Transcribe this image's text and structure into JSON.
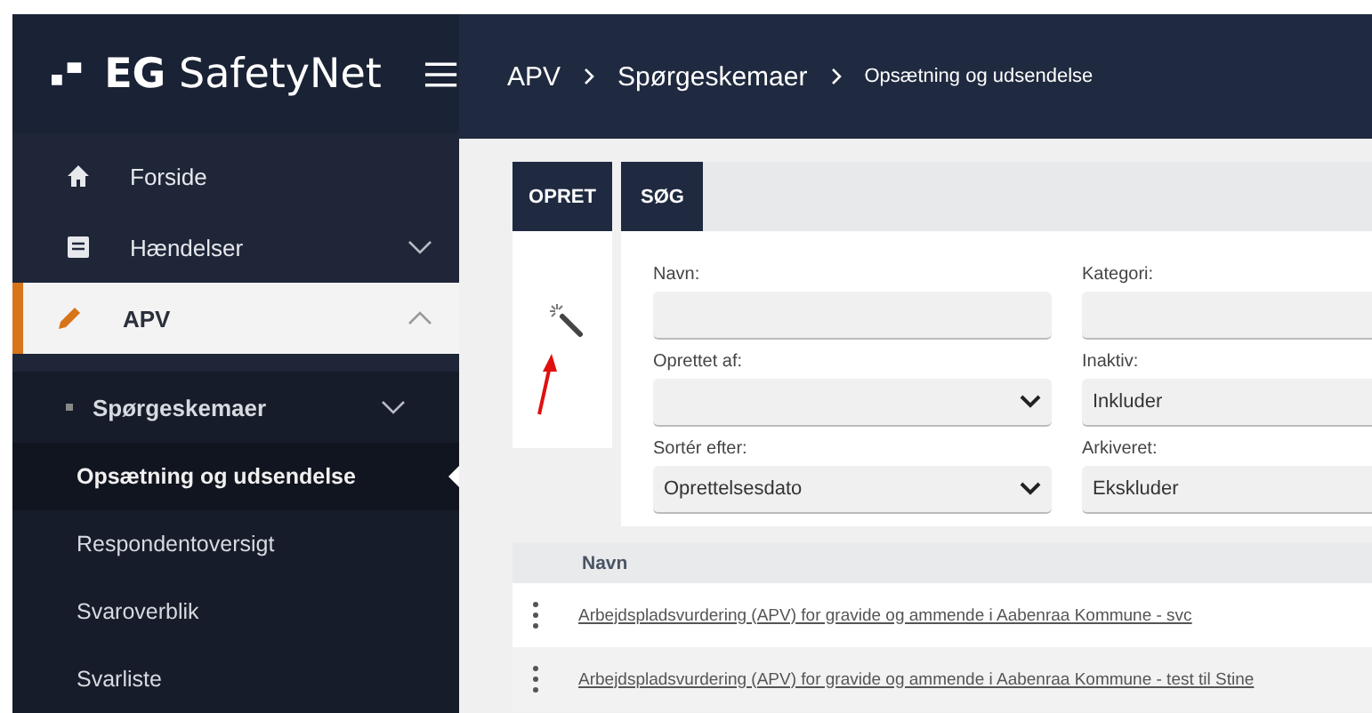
{
  "app": {
    "logo_text": "**EG** SafetyNet"
  },
  "breadcrumb": [
    {
      "label": "APV",
      "kind": "large"
    },
    {
      "label": "Spørgeskemaer",
      "kind": "large"
    },
    {
      "label": "Opsætning og udsendelse",
      "kind": "small"
    }
  ],
  "sidebar": {
    "items": [
      {
        "label": "Forside",
        "selected": false
      },
      {
        "label": "Hændelser",
        "selected": false,
        "expanded": false
      },
      {
        "label": "APV",
        "selected": true,
        "expanded": true,
        "children": [
          {
            "label": "Spørgeskemaer",
            "expanded": false,
            "children": [
              {
                "label": "Opsætning og udsendelse",
                "selected": true
              },
              {
                "label": "Respondentoversigt",
                "selected": false
              },
              {
                "label": "Svaroverblik",
                "selected": false
              },
              {
                "label": "Svarliste",
                "selected": false
              }
            ]
          }
        ]
      }
    ]
  },
  "tabs": [
    {
      "label": "OPRET"
    },
    {
      "label": "SØG"
    }
  ],
  "search_form": {
    "fields": [
      {
        "label": "Navn:",
        "kind": "text"
      },
      {
        "label": "Kategori:",
        "kind": "text"
      },
      {
        "label": "Oprettet af:",
        "kind": "select"
      },
      {
        "label": "Inaktiv:",
        "kind": "text",
        "value": "Inkluder"
      },
      {
        "label": "Sortér efter:",
        "kind": "select",
        "value": "Oprettelsesdato"
      },
      {
        "label": "Arkiveret:",
        "kind": "text",
        "value": "Ekskluder"
      }
    ]
  },
  "table": {
    "columns": [
      "Navn"
    ],
    "rows": [
      {
        "name": "Arbejdspladsvurdering (APV) for gravide og ammende i Aabenraa Kommune - svc"
      },
      {
        "name": "Arbejdspladsvurdering (APV) for gravide og ammende i Aabenraa Kommune - test til Stine"
      }
    ]
  }
}
